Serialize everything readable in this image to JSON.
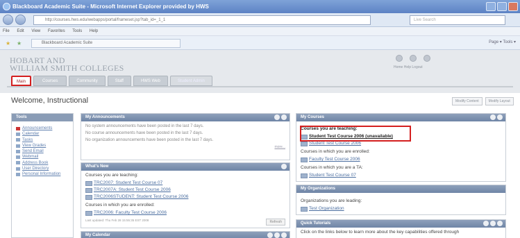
{
  "window": {
    "title": "Blackboard Academic Suite - Microsoft Internet Explorer provided by HWS"
  },
  "browser": {
    "url": "http://courses.hws.edu/webapps/portal/frameset.jsp?tab_id=_1_1",
    "search_placeholder": "Live Search",
    "menu": [
      "File",
      "Edit",
      "View",
      "Favorites",
      "Tools",
      "Help"
    ],
    "tab_title": "Blackboard Academic Suite",
    "toolbar_right": "Page ▾  Tools ▾"
  },
  "header": {
    "logo_line1": "HOBART AND",
    "logo_line2": "WILLIAM SMITH COLLEGES",
    "top_links": "Home  Help  Logout",
    "tabs": [
      {
        "label": "Main"
      },
      {
        "label": "Courses"
      },
      {
        "label": "Community"
      },
      {
        "label": "Staff"
      },
      {
        "label": "HWS Web"
      },
      {
        "label": "Student Admin"
      }
    ]
  },
  "page": {
    "welcome": "Welcome, Instructional",
    "modify_content": "Modify Content",
    "modify_layout": "Modify Layout"
  },
  "tools": {
    "title": "Tools",
    "items": [
      "Announcements",
      "Calendar",
      "Tasks",
      "View Grades",
      "Send Email",
      "Webmail",
      "Address Book",
      "User Directory",
      "Personal Information"
    ]
  },
  "announcements": {
    "title": "My Announcements",
    "lines": [
      "No system announcements have been posted in the last 7 days.",
      "No course announcements have been posted in the last 7 days.",
      "No organization announcements have been posted in the last 7 days."
    ],
    "more": "more..."
  },
  "whats_new": {
    "title": "What's New",
    "teaching_label": "Courses you are teaching:",
    "teaching": [
      "TRC2007: Student Test Course 07",
      "TRC2007A: Student Test Course 2006",
      "TRC2006STUDENT: Student Test Course 2006"
    ],
    "enrolled_label": "Courses in which you are enrolled:",
    "enrolled": [
      "TRC2006: Faculty Test Course 2006"
    ],
    "updated": "Last updated: Thu Feb 28 15:55:35 EST 2008",
    "refresh": "Refresh"
  },
  "calendar": {
    "title": "My Calendar"
  },
  "my_courses": {
    "title": "My Courses",
    "teaching_label": "Courses you are teaching:",
    "teaching_first": "Student Test Course 2006",
    "teaching_first_note": "(unavailable)",
    "teaching_second": "Student Test Course 2006",
    "enrolled_label": "Courses in which you are enrolled:",
    "enrolled": [
      "Faculty Test Course 2006"
    ],
    "ta_label": "Courses in which you are a TA:",
    "ta": [
      "Student Test Course 07"
    ]
  },
  "orgs": {
    "title": "My Organizations",
    "leading_label": "Organizations you are leading:",
    "leading": [
      "Test Organization"
    ]
  },
  "tutorials": {
    "title": "Quick Tutorials",
    "text": "Click on the links below to learn more about the key capabilities offered through"
  }
}
